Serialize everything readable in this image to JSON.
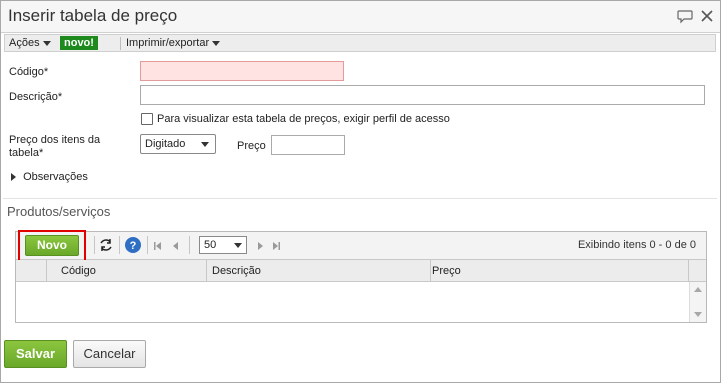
{
  "window": {
    "title": "Inserir tabela de preço"
  },
  "menubar": {
    "acoes_label": "Ações",
    "badge_label": "novo!",
    "imprimir_label": "Imprimir/exportar"
  },
  "form": {
    "codigo_label": "Código*",
    "codigo_value": "",
    "descricao_label": "Descrição*",
    "descricao_value": "",
    "checkbox_label": "Para visualizar esta tabela de preços, exigir perfil de acesso",
    "checkbox_checked": false,
    "preco_itens_label_line1": "Preço dos itens da",
    "preco_itens_label_line2": "tabela*",
    "preco_itens_selected": "Digitado",
    "preco_label": "Preço",
    "preco_value": "",
    "observacoes_label": "Observações"
  },
  "produtos": {
    "section_title": "Produtos/serviços",
    "novo_label": "Novo",
    "page_size": "50",
    "items_status": "Exibindo itens 0 - 0 de 0",
    "columns": [
      "Código",
      "Descrição",
      "Preço"
    ],
    "rows": []
  },
  "footer": {
    "salvar_label": "Salvar",
    "cancelar_label": "Cancelar"
  },
  "colors": {
    "primary_green": "#6aa82a",
    "badge_green": "#1e8a1e",
    "required_bg": "#ffe2e2",
    "highlight_red": "#e00000",
    "help_blue": "#2f6fc3"
  },
  "icons": {
    "comment": "comment-icon",
    "close": "close-icon",
    "refresh": "refresh-icon",
    "help": "help-icon",
    "first_page": "first-page-icon",
    "prev_page": "prev-page-icon",
    "next_page": "next-page-icon",
    "last_page": "last-page-icon",
    "expand": "expand-triangle-icon"
  }
}
